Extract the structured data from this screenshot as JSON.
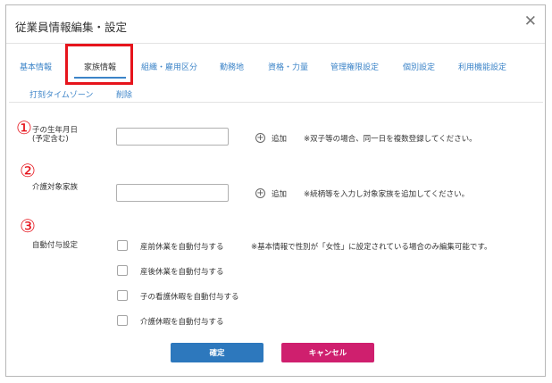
{
  "dialog": {
    "title": "従業員情報編集・設定"
  },
  "tabs": [
    {
      "label": "基本情報"
    },
    {
      "label": "家族情報"
    },
    {
      "label": "組織・雇用区分"
    },
    {
      "label": "勤務地"
    },
    {
      "label": "資格・力量"
    },
    {
      "label": "管理権限設定"
    },
    {
      "label": "個別設定"
    },
    {
      "label": "利用機能設定"
    },
    {
      "label": "打刻タイムゾーン"
    },
    {
      "label": "削除"
    }
  ],
  "active_tab": "家族情報",
  "sections": {
    "child_birthdate": {
      "number": "①",
      "label_line1": "子の生年月日",
      "label_line2": "(予定含む)",
      "input_value": "",
      "add_label": "追加",
      "note": "※双子等の場合、同一日を複数登録してください。"
    },
    "care_family": {
      "number": "②",
      "label": "介護対象家族",
      "input_value": "",
      "add_label": "追加",
      "note": "※続柄等を入力し対象家族を追加してください。"
    },
    "auto_grant": {
      "number": "③",
      "label": "自動付与設定",
      "note": "※基本情報で性別が「女性」に設定されている場合のみ編集可能です。",
      "checkboxes": [
        {
          "label": "産前休業を自動付与する",
          "checked": false
        },
        {
          "label": "産後休業を自動付与する",
          "checked": false
        },
        {
          "label": "子の看護休暇を自動付与する",
          "checked": false
        },
        {
          "label": "介護休暇を自動付与する",
          "checked": false
        }
      ]
    }
  },
  "buttons": {
    "confirm": "確定",
    "cancel": "キャンセル"
  },
  "icons": {
    "close": "close-icon",
    "add": "plus-circle-icon"
  },
  "colors": {
    "accent": "#3c84c8",
    "highlight": "#e6141c",
    "confirm": "#2d78bd",
    "cancel": "#cf1f6e"
  }
}
